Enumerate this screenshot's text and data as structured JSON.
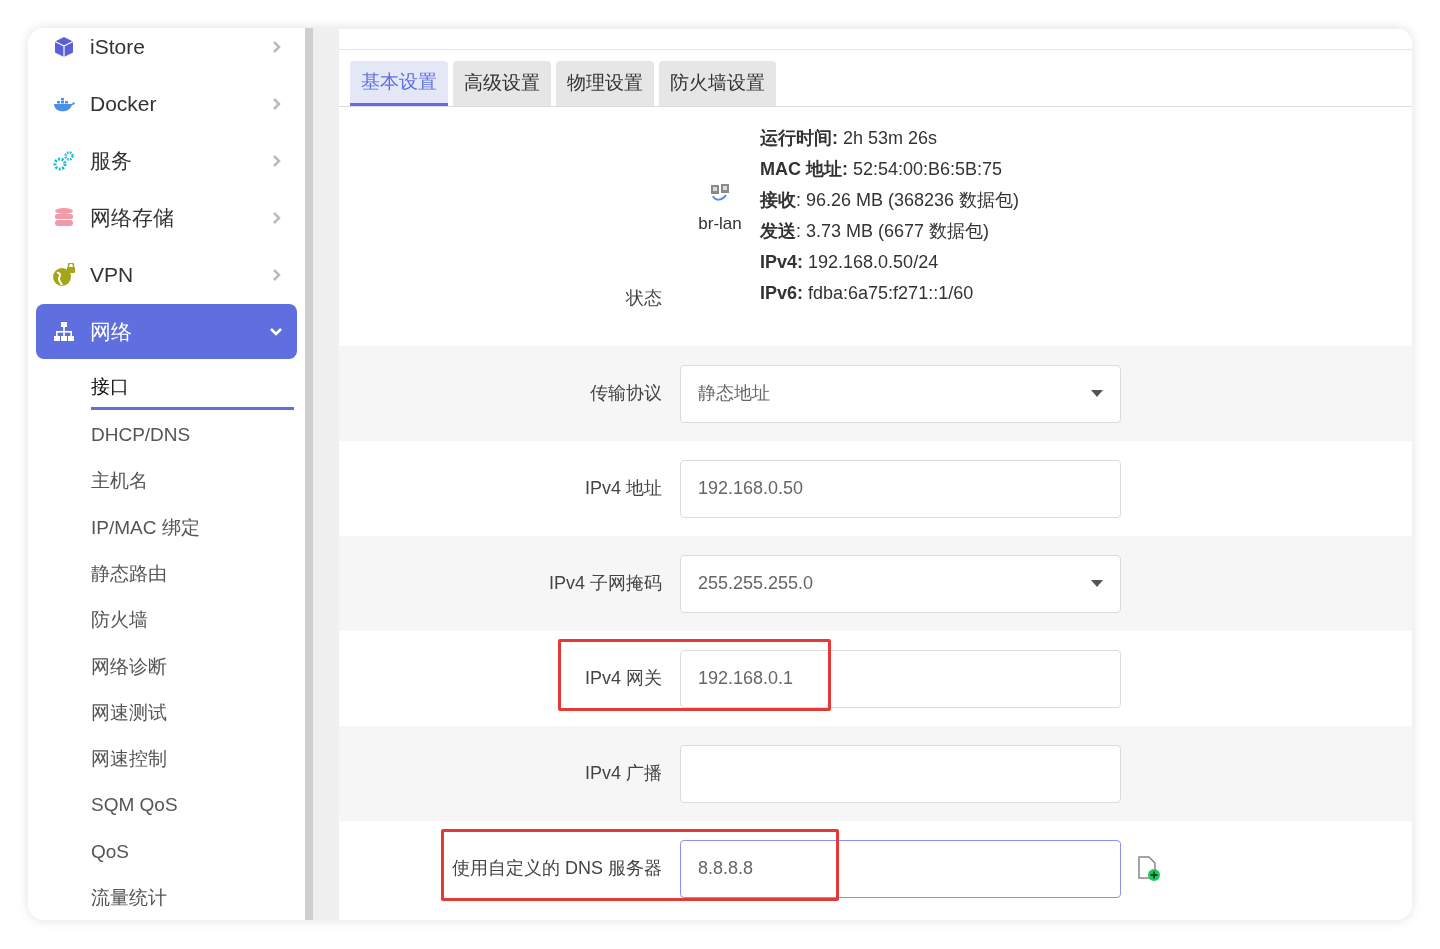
{
  "sidebar": {
    "items": [
      {
        "label": "iStore",
        "selected": false,
        "expanded": false
      },
      {
        "label": "Docker",
        "selected": false,
        "expanded": false
      },
      {
        "label": "服务",
        "selected": false,
        "expanded": false
      },
      {
        "label": "网络存储",
        "selected": false,
        "expanded": false
      },
      {
        "label": "VPN",
        "selected": false,
        "expanded": false
      },
      {
        "label": "网络",
        "selected": true,
        "expanded": true,
        "children": [
          {
            "label": "接口",
            "selected": true
          },
          {
            "label": "DHCP/DNS",
            "selected": false
          },
          {
            "label": "主机名",
            "selected": false
          },
          {
            "label": "IP/MAC 绑定",
            "selected": false
          },
          {
            "label": "静态路由",
            "selected": false
          },
          {
            "label": "防火墙",
            "selected": false
          },
          {
            "label": "网络诊断",
            "selected": false
          },
          {
            "label": "网速测试",
            "selected": false
          },
          {
            "label": "网速控制",
            "selected": false
          },
          {
            "label": "SQM QoS",
            "selected": false
          },
          {
            "label": "QoS",
            "selected": false
          },
          {
            "label": "流量统计",
            "selected": false
          }
        ]
      }
    ]
  },
  "tabs": [
    {
      "label": "基本设置",
      "selected": true
    },
    {
      "label": "高级设置",
      "selected": false
    },
    {
      "label": "物理设置",
      "selected": false
    },
    {
      "label": "防火墙设置",
      "selected": false
    }
  ],
  "status": {
    "label": "状态",
    "device": "br-lan",
    "lines": [
      {
        "key": "运行时间:",
        "value": " 2h 53m 26s"
      },
      {
        "key": "MAC 地址:",
        "value": " 52:54:00:B6:5B:75"
      },
      {
        "key": "接收",
        "value": ": 96.26 MB (368236 数据包)"
      },
      {
        "key": "发送",
        "value": ": 3.73 MB (6677 数据包)"
      },
      {
        "key": "IPv4:",
        "value": " 192.168.0.50/24"
      },
      {
        "key": "IPv6:",
        "value": " fdba:6a75:f271::1/60"
      }
    ]
  },
  "fields": [
    {
      "label": "传输协议",
      "kind": "select",
      "value": "静态地址",
      "highlighted": false,
      "focused": false,
      "add_button": false
    },
    {
      "label": "IPv4 地址",
      "kind": "input",
      "value": "192.168.0.50",
      "highlighted": false,
      "focused": false,
      "add_button": false
    },
    {
      "label": "IPv4 子网掩码",
      "kind": "select",
      "value": "255.255.255.0",
      "highlighted": false,
      "focused": false,
      "add_button": false
    },
    {
      "label": "IPv4 网关",
      "kind": "input",
      "value": "192.168.0.1",
      "highlighted": true,
      "focused": false,
      "add_button": false
    },
    {
      "label": "IPv4 广播",
      "kind": "input",
      "highlighted": false,
      "focused": false,
      "add_button": false
    },
    {
      "label": "使用自定义的 DNS 服务器",
      "kind": "input",
      "value": "8.8.8.8",
      "highlighted": true,
      "focused": true,
      "add_button": true
    }
  ]
}
